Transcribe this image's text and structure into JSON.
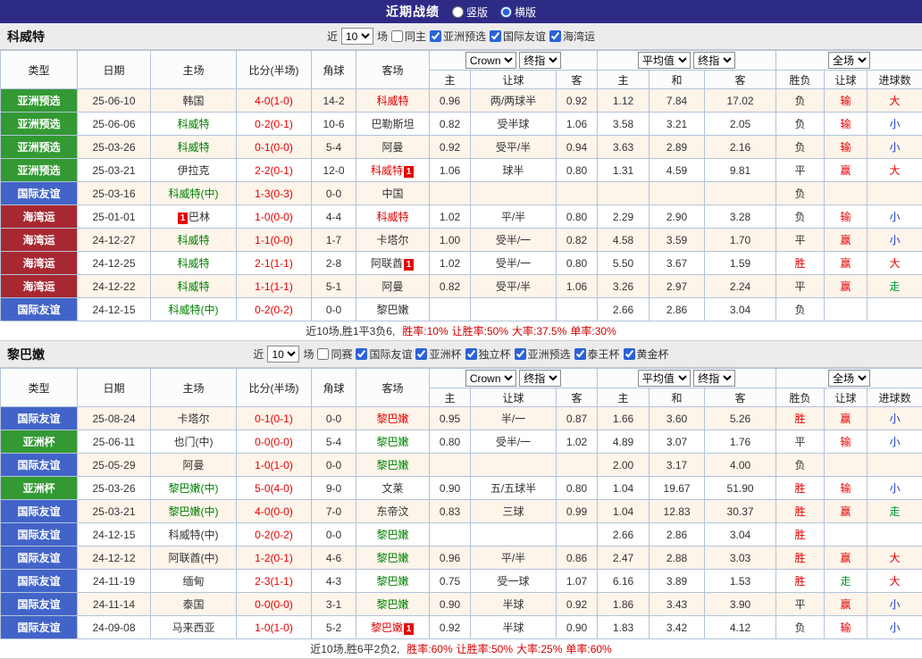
{
  "topbar": {
    "title": "近期战绩",
    "options": [
      "竖版",
      "横版"
    ],
    "selected": "横版"
  },
  "type_colors": {
    "亚洲预选": "#339933",
    "国际友谊": "#4264c8",
    "海湾运": "#a82832",
    "亚洲杯": "#339933"
  },
  "name_colors": {
    "green": "#008000",
    "red": "#e60000",
    "black": "#333333"
  },
  "result_colors": {
    "胜": "#e60000",
    "平": "#333333",
    "负": "#333333",
    "赢": "#e60000",
    "输": "#e60000",
    "走": "#009933",
    "大": "#e60000",
    "小": "#1f3fcc"
  },
  "score_color": "#e60000",
  "sections": [
    {
      "team": "科威特",
      "filter": {
        "prefix": "近",
        "count": "10",
        "suffix": "场",
        "same": {
          "label": "同主",
          "checked": false
        },
        "comps": [
          {
            "label": "亚洲预选",
            "checked": true
          },
          {
            "label": "国际友谊",
            "checked": true
          },
          {
            "label": "海湾运",
            "checked": true
          }
        ]
      },
      "header": {
        "cols": [
          "类型",
          "日期",
          "主场",
          "比分(半场)",
          "角球",
          "客场"
        ],
        "odds_source": "Crown",
        "odds_stage": "终指",
        "avg_source": "平均值",
        "avg_stage": "终指",
        "scope": "全场",
        "sub": [
          "主",
          "让球",
          "客",
          "主",
          "和",
          "客",
          "胜负",
          "让球",
          "进球数"
        ]
      },
      "rows": [
        {
          "type": "亚洲预选",
          "date": "25-06-10",
          "home": "韩国",
          "home_color": "black",
          "home_badge": "",
          "home_badge_pos": "after",
          "score": "4-0(1-0)",
          "corner": "14-2",
          "away": "科威特",
          "away_color": "red",
          "away_badge": "",
          "away_badge_pos": "after",
          "o1": "0.96",
          "line": "两/两球半",
          "o2": "0.92",
          "a1": "1.12",
          "a2": "7.84",
          "a3": "17.02",
          "res": "负",
          "rang": "输",
          "total": "大"
        },
        {
          "type": "亚洲预选",
          "date": "25-06-06",
          "home": "科威特",
          "home_color": "green",
          "home_badge": "",
          "home_badge_pos": "after",
          "score": "0-2(0-1)",
          "corner": "10-6",
          "away": "巴勒斯坦",
          "away_color": "black",
          "away_badge": "",
          "away_badge_pos": "after",
          "o1": "0.82",
          "line": "受半球",
          "o2": "1.06",
          "a1": "3.58",
          "a2": "3.21",
          "a3": "2.05",
          "res": "负",
          "rang": "输",
          "total": "小"
        },
        {
          "type": "亚洲预选",
          "date": "25-03-26",
          "home": "科威特",
          "home_color": "green",
          "home_badge": "",
          "home_badge_pos": "after",
          "score": "0-1(0-0)",
          "corner": "5-4",
          "away": "阿曼",
          "away_color": "black",
          "away_badge": "",
          "away_badge_pos": "after",
          "o1": "0.92",
          "line": "受平/半",
          "o2": "0.94",
          "a1": "3.63",
          "a2": "2.89",
          "a3": "2.16",
          "res": "负",
          "rang": "输",
          "total": "小"
        },
        {
          "type": "亚洲预选",
          "date": "25-03-21",
          "home": "伊拉克",
          "home_color": "black",
          "home_badge": "",
          "home_badge_pos": "after",
          "score": "2-2(0-1)",
          "corner": "12-0",
          "away": "科威特",
          "away_color": "red",
          "away_badge": "1",
          "away_badge_pos": "after",
          "o1": "1.06",
          "line": "球半",
          "o2": "0.80",
          "a1": "1.31",
          "a2": "4.59",
          "a3": "9.81",
          "res": "平",
          "rang": "赢",
          "total": "大"
        },
        {
          "type": "国际友谊",
          "date": "25-03-16",
          "home": "科威特(中)",
          "home_color": "green",
          "home_badge": "",
          "home_badge_pos": "after",
          "score": "1-3(0-3)",
          "corner": "0-0",
          "away": "中国",
          "away_color": "black",
          "away_badge": "",
          "away_badge_pos": "after",
          "o1": "",
          "line": "",
          "o2": "",
          "a1": "",
          "a2": "",
          "a3": "",
          "res": "负",
          "rang": "",
          "total": ""
        },
        {
          "type": "海湾运",
          "date": "25-01-01",
          "home": "巴林",
          "home_color": "black",
          "home_badge": "1",
          "home_badge_pos": "before",
          "score": "1-0(0-0)",
          "corner": "4-4",
          "away": "科威特",
          "away_color": "red",
          "away_badge": "",
          "away_badge_pos": "after",
          "o1": "1.02",
          "line": "平/半",
          "o2": "0.80",
          "a1": "2.29",
          "a2": "2.90",
          "a3": "3.28",
          "res": "负",
          "rang": "输",
          "total": "小"
        },
        {
          "type": "海湾运",
          "date": "24-12-27",
          "home": "科威特",
          "home_color": "green",
          "home_badge": "",
          "home_badge_pos": "after",
          "score": "1-1(0-0)",
          "corner": "1-7",
          "away": "卡塔尔",
          "away_color": "black",
          "away_badge": "",
          "away_badge_pos": "after",
          "o1": "1.00",
          "line": "受半/一",
          "o2": "0.82",
          "a1": "4.58",
          "a2": "3.59",
          "a3": "1.70",
          "res": "平",
          "rang": "赢",
          "total": "小"
        },
        {
          "type": "海湾运",
          "date": "24-12-25",
          "home": "科威特",
          "home_color": "green",
          "home_badge": "",
          "home_badge_pos": "after",
          "score": "2-1(1-1)",
          "corner": "2-8",
          "away": "阿联酋",
          "away_color": "black",
          "away_badge": "1",
          "away_badge_pos": "after",
          "o1": "1.02",
          "line": "受半/一",
          "o2": "0.80",
          "a1": "5.50",
          "a2": "3.67",
          "a3": "1.59",
          "res": "胜",
          "rang": "赢",
          "total": "大"
        },
        {
          "type": "海湾运",
          "date": "24-12-22",
          "home": "科威特",
          "home_color": "green",
          "home_badge": "",
          "home_badge_pos": "after",
          "score": "1-1(1-1)",
          "corner": "5-1",
          "away": "阿曼",
          "away_color": "black",
          "away_badge": "",
          "away_badge_pos": "after",
          "o1": "0.82",
          "line": "受平/半",
          "o2": "1.06",
          "a1": "3.26",
          "a2": "2.97",
          "a3": "2.24",
          "res": "平",
          "rang": "赢",
          "total": "走"
        },
        {
          "type": "国际友谊",
          "date": "24-12-15",
          "home": "科威特(中)",
          "home_color": "green",
          "home_badge": "",
          "home_badge_pos": "after",
          "score": "0-2(0-2)",
          "corner": "0-0",
          "away": "黎巴嫩",
          "away_color": "black",
          "away_badge": "",
          "away_badge_pos": "after",
          "o1": "",
          "line": "",
          "o2": "",
          "a1": "2.66",
          "a2": "2.86",
          "a3": "3.04",
          "res": "负",
          "rang": "",
          "total": ""
        }
      ],
      "summary": {
        "lead": "近10场,胜1平3负6,",
        "stats": [
          "胜率:10%",
          "让胜率:50%",
          "大率:37.5%",
          "单率:30%"
        ]
      }
    },
    {
      "team": "黎巴嫩",
      "filter": {
        "prefix": "近",
        "count": "10",
        "suffix": "场",
        "same": {
          "label": "同赛",
          "checked": false
        },
        "comps": [
          {
            "label": "国际友谊",
            "checked": true
          },
          {
            "label": "亚洲杯",
            "checked": true
          },
          {
            "label": "独立杯",
            "checked": true
          },
          {
            "label": "亚洲预选",
            "checked": true
          },
          {
            "label": "泰王杯",
            "checked": true
          },
          {
            "label": "黄金杯",
            "checked": true
          }
        ]
      },
      "header": {
        "cols": [
          "类型",
          "日期",
          "主场",
          "比分(半场)",
          "角球",
          "客场"
        ],
        "odds_source": "Crown",
        "odds_stage": "终指",
        "avg_source": "平均值",
        "avg_stage": "终指",
        "scope": "全场",
        "sub": [
          "主",
          "让球",
          "客",
          "主",
          "和",
          "客",
          "胜负",
          "让球",
          "进球数"
        ]
      },
      "rows": [
        {
          "type": "国际友谊",
          "date": "25-08-24",
          "home": "卡塔尔",
          "home_color": "black",
          "home_badge": "",
          "home_badge_pos": "after",
          "score": "0-1(0-1)",
          "corner": "0-0",
          "away": "黎巴嫩",
          "away_color": "red",
          "away_badge": "",
          "away_badge_pos": "after",
          "o1": "0.95",
          "line": "半/一",
          "o2": "0.87",
          "a1": "1.66",
          "a2": "3.60",
          "a3": "5.26",
          "res": "胜",
          "rang": "赢",
          "total": "小"
        },
        {
          "type": "亚洲杯",
          "date": "25-06-11",
          "home": "也门(中)",
          "home_color": "black",
          "home_badge": "",
          "home_badge_pos": "after",
          "score": "0-0(0-0)",
          "corner": "5-4",
          "away": "黎巴嫩",
          "away_color": "green",
          "away_badge": "",
          "away_badge_pos": "after",
          "o1": "0.80",
          "line": "受半/一",
          "o2": "1.02",
          "a1": "4.89",
          "a2": "3.07",
          "a3": "1.76",
          "res": "平",
          "rang": "输",
          "total": "小"
        },
        {
          "type": "国际友谊",
          "date": "25-05-29",
          "home": "阿曼",
          "home_color": "black",
          "home_badge": "",
          "home_badge_pos": "after",
          "score": "1-0(1-0)",
          "corner": "0-0",
          "away": "黎巴嫩",
          "away_color": "green",
          "away_badge": "",
          "away_badge_pos": "after",
          "o1": "",
          "line": "",
          "o2": "",
          "a1": "2.00",
          "a2": "3.17",
          "a3": "4.00",
          "res": "负",
          "rang": "",
          "total": ""
        },
        {
          "type": "亚洲杯",
          "date": "25-03-26",
          "home": "黎巴嫩(中)",
          "home_color": "green",
          "home_badge": "",
          "home_badge_pos": "after",
          "score": "5-0(4-0)",
          "corner": "9-0",
          "away": "文莱",
          "away_color": "black",
          "away_badge": "",
          "away_badge_pos": "after",
          "o1": "0.90",
          "line": "五/五球半",
          "o2": "0.80",
          "a1": "1.04",
          "a2": "19.67",
          "a3": "51.90",
          "res": "胜",
          "rang": "输",
          "total": "小"
        },
        {
          "type": "国际友谊",
          "date": "25-03-21",
          "home": "黎巴嫩(中)",
          "home_color": "green",
          "home_badge": "",
          "home_badge_pos": "after",
          "score": "4-0(0-0)",
          "corner": "7-0",
          "away": "东帝汶",
          "away_color": "black",
          "away_badge": "",
          "away_badge_pos": "after",
          "o1": "0.83",
          "line": "三球",
          "o2": "0.99",
          "a1": "1.04",
          "a2": "12.83",
          "a3": "30.37",
          "res": "胜",
          "rang": "赢",
          "total": "走"
        },
        {
          "type": "国际友谊",
          "date": "24-12-15",
          "home": "科威特(中)",
          "home_color": "black",
          "home_badge": "",
          "home_badge_pos": "after",
          "score": "0-2(0-2)",
          "corner": "0-0",
          "away": "黎巴嫩",
          "away_color": "green",
          "away_badge": "",
          "away_badge_pos": "after",
          "o1": "",
          "line": "",
          "o2": "",
          "a1": "2.66",
          "a2": "2.86",
          "a3": "3.04",
          "res": "胜",
          "rang": "",
          "total": ""
        },
        {
          "type": "国际友谊",
          "date": "24-12-12",
          "home": "阿联酋(中)",
          "home_color": "black",
          "home_badge": "",
          "home_badge_pos": "after",
          "score": "1-2(0-1)",
          "corner": "4-6",
          "away": "黎巴嫩",
          "away_color": "green",
          "away_badge": "",
          "away_badge_pos": "after",
          "o1": "0.96",
          "line": "平/半",
          "o2": "0.86",
          "a1": "2.47",
          "a2": "2.88",
          "a3": "3.03",
          "res": "胜",
          "rang": "赢",
          "total": "大"
        },
        {
          "type": "国际友谊",
          "date": "24-11-19",
          "home": "缅甸",
          "home_color": "black",
          "home_badge": "",
          "home_badge_pos": "after",
          "score": "2-3(1-1)",
          "corner": "4-3",
          "away": "黎巴嫩",
          "away_color": "green",
          "away_badge": "",
          "away_badge_pos": "after",
          "o1": "0.75",
          "line": "受一球",
          "o2": "1.07",
          "a1": "6.16",
          "a2": "3.89",
          "a3": "1.53",
          "res": "胜",
          "rang": "走",
          "total": "大"
        },
        {
          "type": "国际友谊",
          "date": "24-11-14",
          "home": "泰国",
          "home_color": "black",
          "home_badge": "",
          "home_badge_pos": "after",
          "score": "0-0(0-0)",
          "corner": "3-1",
          "away": "黎巴嫩",
          "away_color": "green",
          "away_badge": "",
          "away_badge_pos": "after",
          "o1": "0.90",
          "line": "半球",
          "o2": "0.92",
          "a1": "1.86",
          "a2": "3.43",
          "a3": "3.90",
          "res": "平",
          "rang": "赢",
          "total": "小"
        },
        {
          "type": "国际友谊",
          "date": "24-09-08",
          "home": "马来西亚",
          "home_color": "black",
          "home_badge": "",
          "home_badge_pos": "after",
          "score": "1-0(1-0)",
          "corner": "5-2",
          "away": "黎巴嫩",
          "away_color": "red",
          "away_badge": "1",
          "away_badge_pos": "after",
          "o1": "0.92",
          "line": "半球",
          "o2": "0.90",
          "a1": "1.83",
          "a2": "3.42",
          "a3": "4.12",
          "res": "负",
          "rang": "输",
          "total": "小"
        }
      ],
      "summary": {
        "lead": "近10场,胜6平2负2,",
        "stats": [
          "胜率:60%",
          "让胜率:50%",
          "大率:25%",
          "单率:60%"
        ]
      }
    }
  ]
}
